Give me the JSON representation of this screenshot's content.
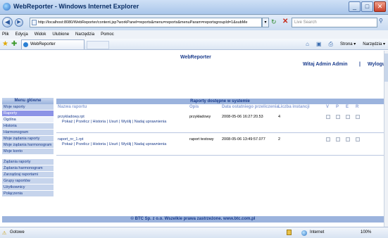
{
  "window": {
    "title": "WebReporter - Windows Internet Explorer",
    "minimize": "_",
    "maximize": "□",
    "close": "✕"
  },
  "nav": {
    "back": "◀",
    "forward": "▶",
    "address": "http://localhost:8080/WebReporter/content.jsp?workPanel=reports&menu=reports&menuParam=reportsgroupId=1&subMe",
    "search_placeholder": "Live Search",
    "refresh": "↻",
    "stop": "✕",
    "search_go": "⚲"
  },
  "menu": {
    "items": [
      "Plik",
      "Edycja",
      "Widok",
      "Ulubione",
      "Narzędzia",
      "Pomoc"
    ]
  },
  "favorites": {
    "tab_label": "WebReporter",
    "tools": [
      "Strona ▾",
      "Narzędzia ▾"
    ]
  },
  "page": {
    "title": "WebReporter",
    "welcome": "Witaj Admin Admin",
    "separator": "|",
    "logout": "Wyloguj"
  },
  "sidebar": {
    "heading": "Menu główne",
    "items": [
      {
        "label": "Moje raporty",
        "state": "normal"
      },
      {
        "label": "Raporty",
        "state": "active"
      },
      {
        "label": "Ogólna",
        "state": "sub"
      },
      {
        "label": "Historia",
        "state": "normal"
      },
      {
        "label": "Harmonogram",
        "state": "normal"
      },
      {
        "label": "Moje żądania raporty",
        "state": "normal"
      },
      {
        "label": "Moje żądania harmonogram",
        "state": "normal"
      },
      {
        "label": "Moje konto",
        "state": "normal"
      }
    ],
    "admin_items": [
      "Żądania raporty",
      "Żądania harmonogram",
      "Zarządzaj raportami",
      "Grupy raportów",
      "Użytkownicy",
      "Połączenia"
    ]
  },
  "main": {
    "heading": "Raporty dostępne w systemie",
    "columns": [
      "Nazwa raportu",
      "Opis",
      "Data ostatniego przeliczenia",
      "Liczba instancji",
      "V",
      "P",
      "E",
      "R"
    ],
    "rows": [
      {
        "name": "przykladowy.rpt",
        "actions": "Pokaż | Przelicz | Historia | Usuń | Wyślij | Nadaj uprawnienia",
        "desc": "przykładowy",
        "date": "2008-05-06 16:27:20.53",
        "instances": "4"
      },
      {
        "name": "raport_nr_1.rpt",
        "actions": "Pokaż | Przelicz | Historia | Usuń | Wyślij | Nadaj uprawnienia",
        "desc": "raport testowy",
        "date": "2008-05-06 13:49:57.077",
        "instances": "2"
      }
    ]
  },
  "footer": "© BTC Sp. z o.o. Wszelkie prawa zastrzeżone. www.btc.com.pl",
  "status": {
    "text": "Gotowe",
    "zone": "Internet",
    "zoom": "100%"
  }
}
